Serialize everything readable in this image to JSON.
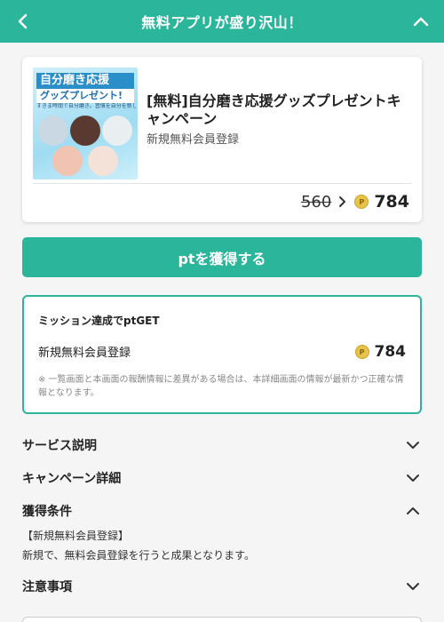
{
  "header": {
    "title": "無料アプリが盛り沢山！",
    "back_icon": "chevron-left-icon",
    "collapse_icon": "chevron-up-icon",
    "bg_color": "#2bb59a"
  },
  "offer": {
    "thumbnail": {
      "line1": "自分磨き応援",
      "line2": "グッズプレゼント!",
      "line3": "すきま時間で自分磨き。習慣を自分を新しくしようぜ!"
    },
    "title": "[無料]自分磨き応援グッズプレゼントキャンペーン",
    "subtitle": "新規無料会員登録",
    "old_points": "560",
    "new_points": "784",
    "coin_symbol": "P"
  },
  "get_button": {
    "label": "ptを獲得する"
  },
  "mission": {
    "heading": "ミッション達成でptGET",
    "label": "新規無料会員登録",
    "points": "784",
    "note": "※ 一覧画面と本画面の報酬情報に差異がある場合は、本詳細画面の情報が最新かつ正確な情報となります。"
  },
  "sections": {
    "service": "サービス説明",
    "campaign": "キャンペーン詳細",
    "conditions": "獲得条件",
    "conditions_label": "【新規無料会員登録】",
    "conditions_text": "新規で、無料会員登録を行うと成果となります。",
    "notes": "注意事項"
  },
  "colors": {
    "accent": "#2bb59a",
    "coin": "#e8c34a"
  }
}
